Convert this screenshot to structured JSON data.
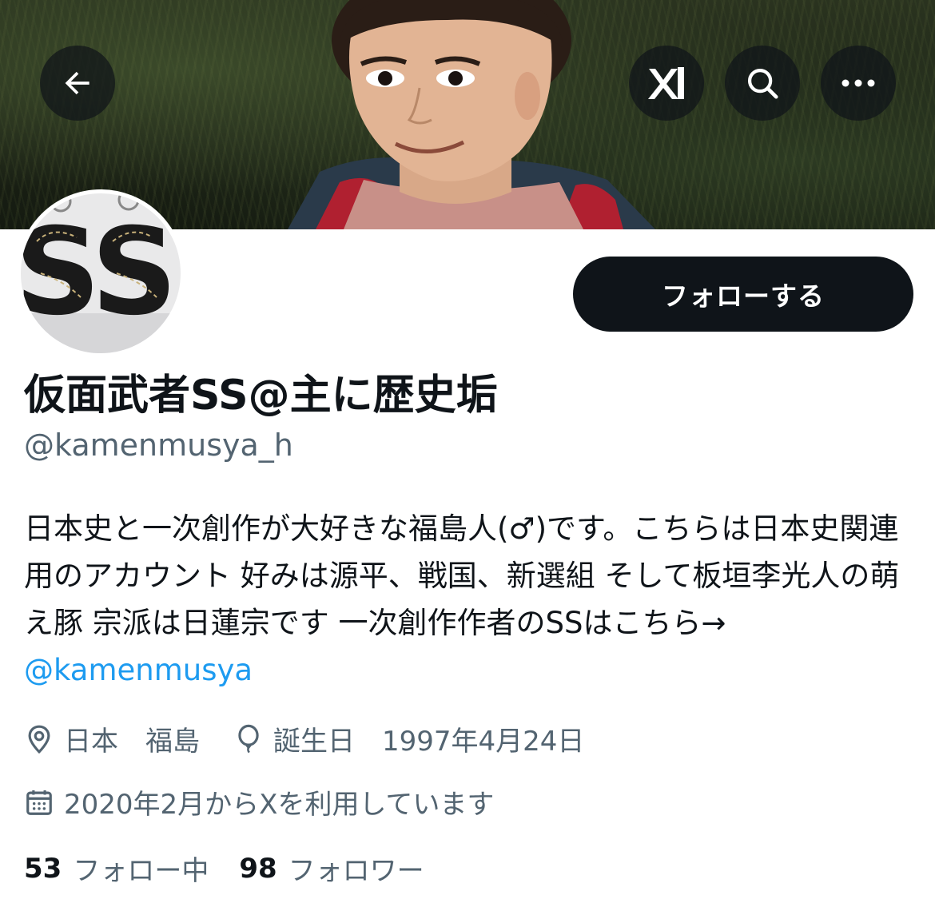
{
  "header": {
    "back_icon": "arrow-left-icon",
    "grok_icon": "grok-icon",
    "search_icon": "search-icon",
    "more_icon": "more-horizontal-icon"
  },
  "profile": {
    "follow_label": "フォローする",
    "name": "仮面武者SS@主に歴史垢",
    "handle": "@kamenmusya_h",
    "bio_text": "日本史と一次創作が大好きな福島人(♂)です。こちらは日本史関連用のアカウント 好みは源平、戦国、新選組 そして板垣李光人の萌え豚 宗派は日蓮宗です 一次創作作者のSSはこちら→ ",
    "bio_link": "@kamenmusya",
    "location": "日本　福島",
    "birthday": "誕生日　1997年4月24日",
    "joined": "2020年2月からXを利用しています",
    "following_count": "53",
    "following_label": "フォロー中",
    "followers_count": "98",
    "followers_label": "フォロワー"
  },
  "colors": {
    "accent": "#1d9bf0",
    "text_primary": "#0f1419",
    "text_secondary": "#536471",
    "button_bg": "#0f1419"
  }
}
